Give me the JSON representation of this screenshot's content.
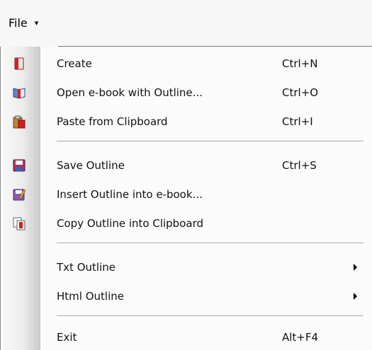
{
  "menubar": {
    "file_label": "File",
    "caret": "▾"
  },
  "menu": {
    "create": {
      "label": "Create",
      "shortcut": "Ctrl+N",
      "icon": "red-book-icon"
    },
    "open": {
      "label": "Open e-book with Outline...",
      "shortcut": "Ctrl+O",
      "icon": "open-book-icon"
    },
    "paste": {
      "label": "Paste from Clipboard",
      "shortcut": "Ctrl+I",
      "icon": "clipboard-paste-icon"
    },
    "save": {
      "label": "Save Outline",
      "shortcut": "Ctrl+S",
      "icon": "floppy-disk-icon"
    },
    "insert": {
      "label": "Insert Outline into e-book...",
      "icon": "edit-floppy-icon"
    },
    "copy": {
      "label": "Copy Outline into Clipboard",
      "icon": "copy-icon"
    },
    "txt": {
      "label": "Txt Outline"
    },
    "html": {
      "label": "Html Outline"
    },
    "exit": {
      "label": "Exit",
      "shortcut": "Alt+F4"
    }
  }
}
